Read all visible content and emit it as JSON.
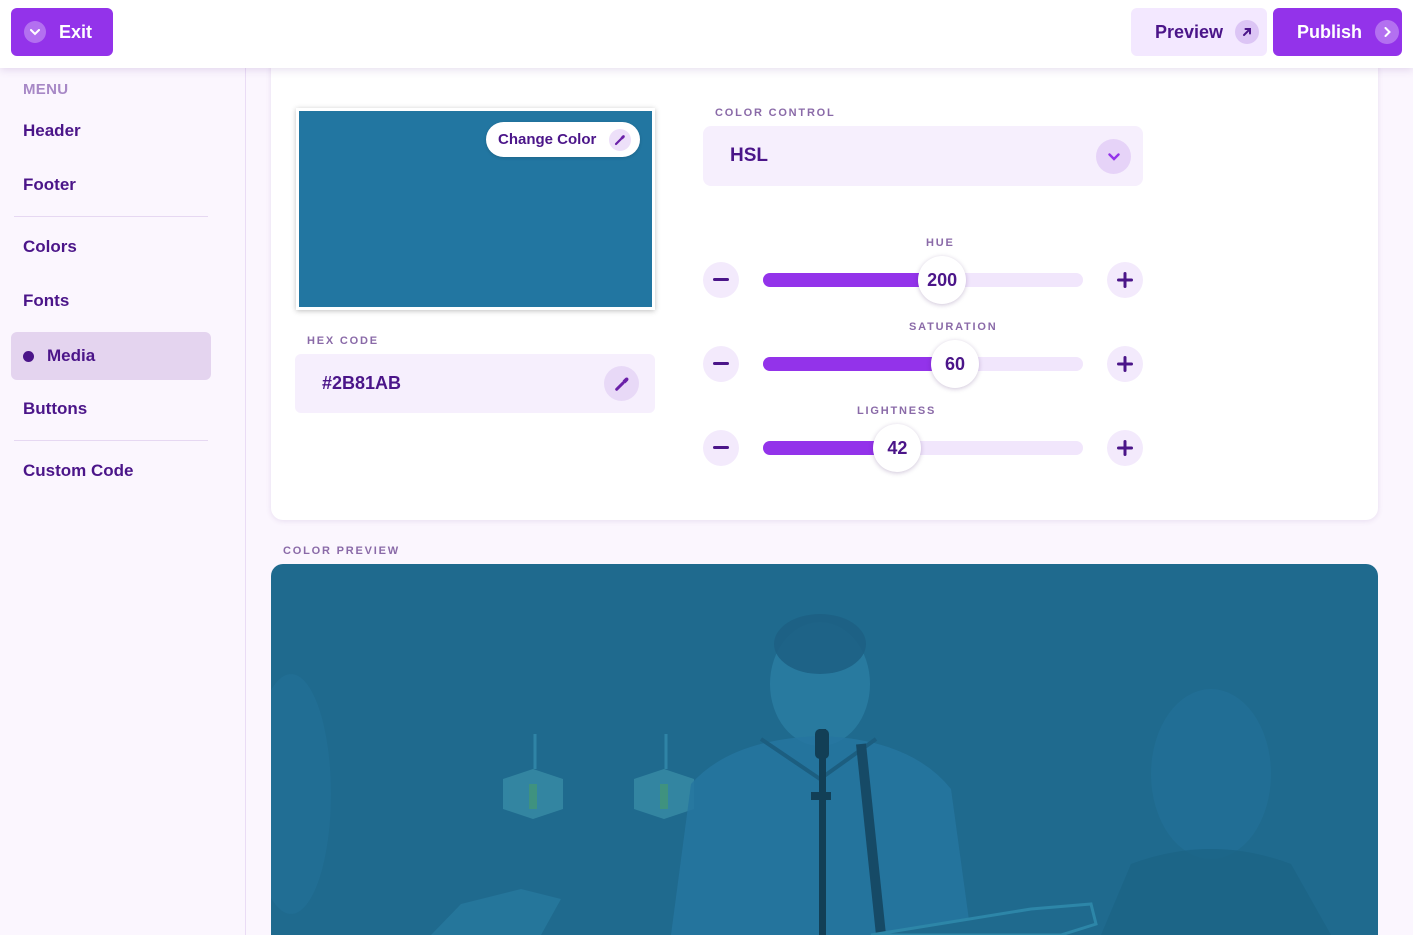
{
  "topbar": {
    "exit_label": "Exit",
    "preview_label": "Preview",
    "publish_label": "Publish"
  },
  "sidebar": {
    "menu_label": "MENU",
    "items": [
      {
        "label": "Header"
      },
      {
        "label": "Footer"
      },
      {
        "label": "Colors"
      },
      {
        "label": "Fonts"
      },
      {
        "label": "Media",
        "active": true
      },
      {
        "label": "Buttons"
      },
      {
        "label": "Custom Code"
      }
    ]
  },
  "color": {
    "change_color_label": "Change Color",
    "swatch_color": "#2276A1",
    "hex_label": "HEX CODE",
    "hex_value": "#2B81AB",
    "control_label": "COLOR CONTROL",
    "control_value": "HSL",
    "sliders": [
      {
        "label": "HUE",
        "value": "200",
        "fraction": 0.56
      },
      {
        "label": "SATURATION",
        "value": "60",
        "fraction": 0.6
      },
      {
        "label": "LIGHTNESS",
        "value": "42",
        "fraction": 0.42
      }
    ]
  },
  "preview": {
    "label": "COLOR PREVIEW",
    "tint": "#1F6A8E"
  },
  "theme": {
    "accent": "#9333EA",
    "text": "#4B1589"
  }
}
